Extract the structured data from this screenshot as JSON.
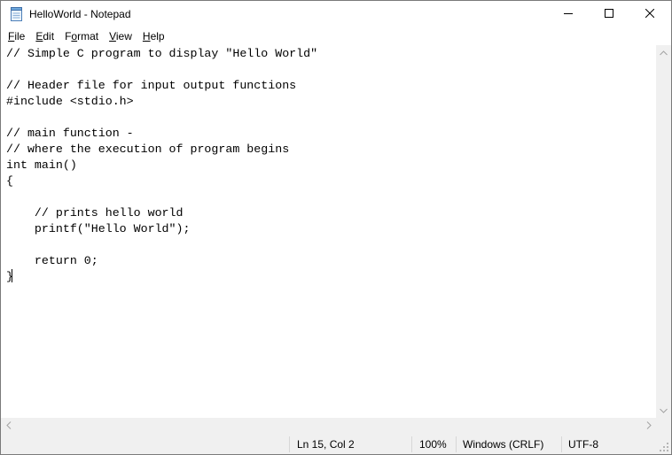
{
  "window": {
    "title": "HelloWorld - Notepad",
    "icon": "notepad-icon"
  },
  "title_buttons": {
    "minimize_icon": "minimize-icon",
    "maximize_icon": "maximize-icon",
    "close_icon": "close-icon"
  },
  "menu": {
    "items": [
      {
        "accel": "F",
        "rest": "ile"
      },
      {
        "accel": "E",
        "rest": "dit"
      },
      {
        "accel": "o",
        "pre": "F",
        "rest": "rmat"
      },
      {
        "accel": "V",
        "rest": "iew"
      },
      {
        "accel": "H",
        "rest": "elp"
      }
    ]
  },
  "editor": {
    "lines": [
      "// Simple C program to display \"Hello World\"",
      "",
      "// Header file for input output functions",
      "#include <stdio.h>",
      "",
      "// main function -",
      "// where the execution of program begins",
      "int main()",
      "{",
      "",
      "    // prints hello world",
      "    printf(\"Hello World\");",
      "",
      "    return 0;",
      "}"
    ]
  },
  "status": {
    "position": "Ln 15, Col 2",
    "zoom": "100%",
    "line_endings": "Windows (CRLF)",
    "encoding": "UTF-8"
  },
  "colors": {
    "chrome": "#f0f0f0",
    "text": "#000000",
    "separator": "#d7d7d7",
    "icon_blue": "#3a7bd5"
  }
}
